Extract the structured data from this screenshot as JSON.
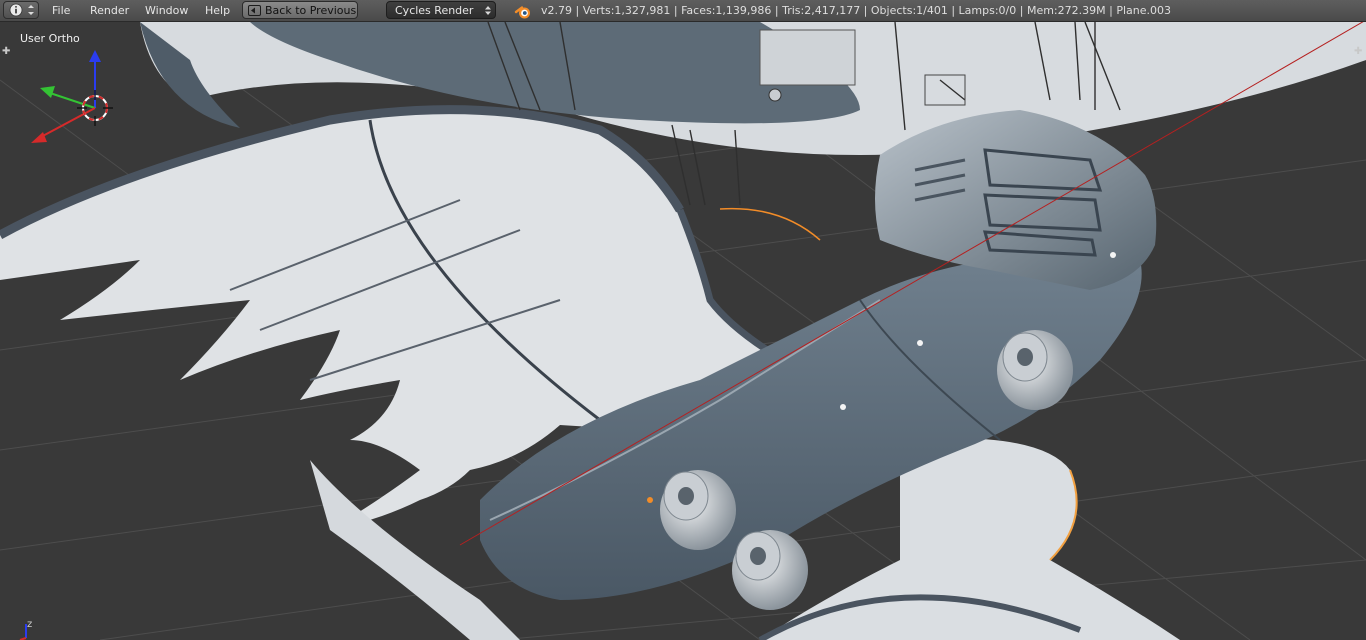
{
  "header": {
    "editor_type_icon": "info-icon",
    "menus": [
      "File",
      "Render",
      "Window",
      "Help"
    ],
    "back_button": "Back to Previous",
    "render_engine": "Cycles Render",
    "stats": "v2.79 | Verts:1,327,981 | Faces:1,139,986 | Tris:2,417,177 | Objects:1/401 | Lamps:0/0 | Mem:272.39M | Plane.003"
  },
  "viewport": {
    "view_label": "User Ortho",
    "axis_x_label": "",
    "axis_y_label": "",
    "axis_z_label": "",
    "corner_axis_label": "z"
  },
  "colors": {
    "header_bg": "#4b4b4b",
    "viewport_bg": "#393939",
    "model_light": "#dcdfe2",
    "model_dark": "#5c6a78",
    "axis_x": "#d62a2a",
    "axis_y": "#34c334",
    "axis_z": "#2a3cf0",
    "selection": "#f28c28"
  }
}
